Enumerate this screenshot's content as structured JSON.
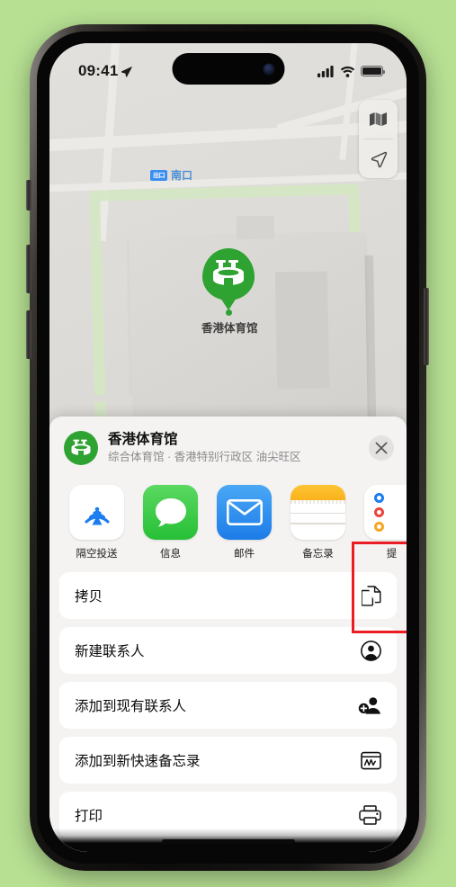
{
  "device": {
    "background_color": "#b7e093",
    "frame_color": "#0d0c0b"
  },
  "status_bar": {
    "time": "09:41",
    "location_arrow_icon": "location-arrow-icon",
    "cellular_icon": "cellular-bars-icon",
    "wifi_icon": "wifi-icon",
    "battery_icon": "battery-full-icon"
  },
  "map": {
    "transit_label": {
      "badge": "出口",
      "name": "南口"
    },
    "poi": {
      "label": "香港体育馆",
      "pin_color": "#2fa331",
      "icon": "stadium-icon"
    },
    "controls": [
      {
        "name": "map-type-button",
        "icon": "folded-map-icon"
      },
      {
        "name": "locate-me-button",
        "icon": "navigation-arrow-icon"
      }
    ]
  },
  "share_sheet": {
    "header": {
      "title": "香港体育馆",
      "subtitle": "综合体育馆 · 香港特别行政区 油尖旺区",
      "avatar_icon": "stadium-icon",
      "close_icon": "close-x-icon"
    },
    "apps": [
      {
        "label": "隔空投送",
        "icon": "airdrop-icon",
        "highlighted": false
      },
      {
        "label": "信息",
        "icon": "messages-icon",
        "highlighted": false
      },
      {
        "label": "邮件",
        "icon": "mail-icon",
        "highlighted": false
      },
      {
        "label": "备忘录",
        "icon": "notes-icon",
        "highlighted": true
      },
      {
        "label": "提",
        "icon": "reminders-icon",
        "highlighted": false
      }
    ],
    "highlight_color": "#ec1c24",
    "actions": [
      {
        "label": "拷贝",
        "icon": "copy-icon"
      },
      {
        "label": "新建联系人",
        "icon": "person-circle-icon"
      },
      {
        "label": "添加到现有联系人",
        "icon": "person-add-icon"
      },
      {
        "label": "添加到新快速备忘录",
        "icon": "quick-note-icon"
      },
      {
        "label": "打印",
        "icon": "printer-icon"
      }
    ]
  }
}
